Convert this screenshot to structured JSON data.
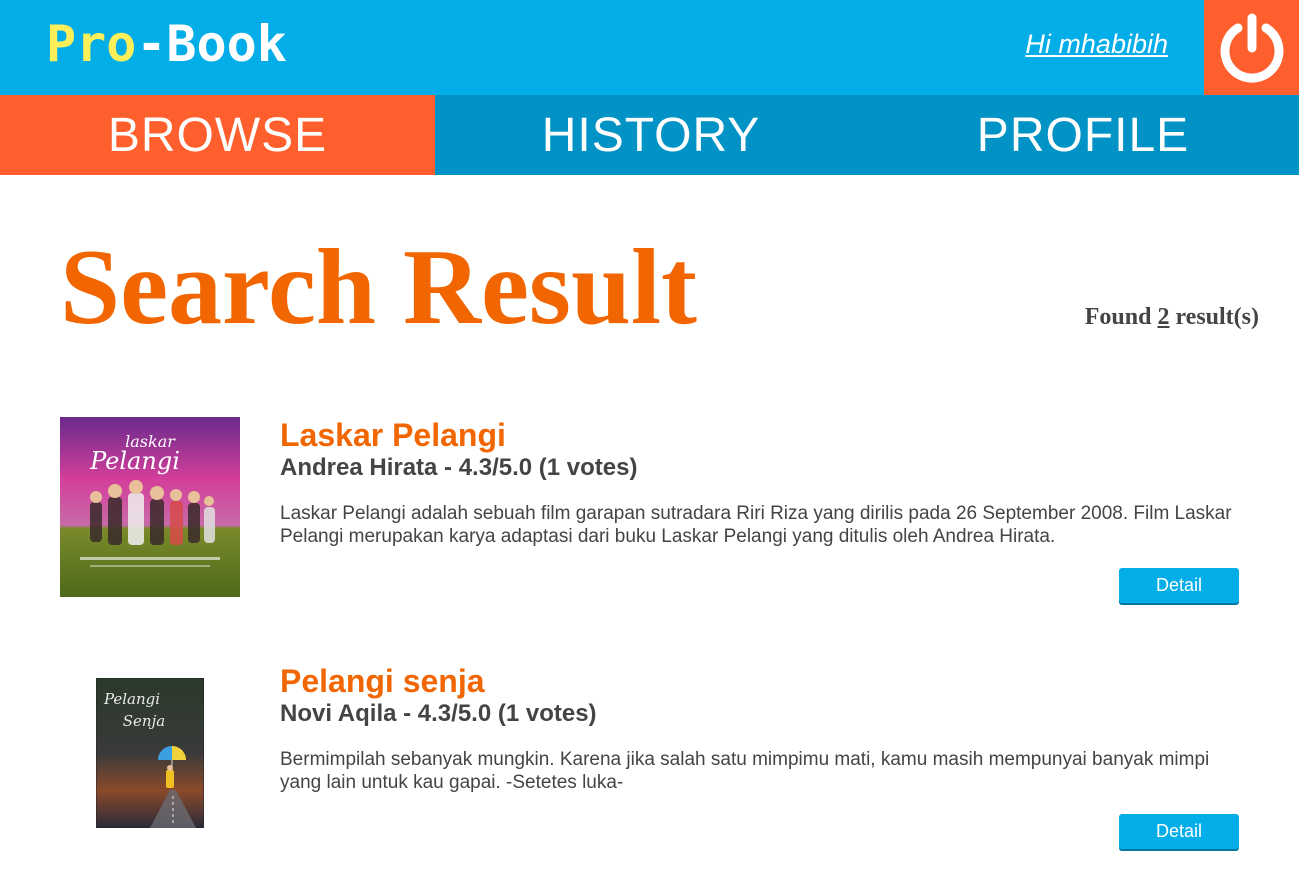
{
  "header": {
    "logo_part1": "Pro",
    "logo_part2": "-Book",
    "greeting": "Hi mhabibih",
    "logout_icon": "power-icon",
    "colors": {
      "bar": "#03aee8",
      "logout": "#ff5f2c",
      "logo_accent": "#fdef5a"
    }
  },
  "nav": {
    "tabs": [
      {
        "label": "BROWSE",
        "active": true
      },
      {
        "label": "HISTORY",
        "active": false
      },
      {
        "label": "PROFILE",
        "active": false
      }
    ]
  },
  "main": {
    "title": "Search Result",
    "found_prefix": "Found",
    "found_count": "2",
    "found_suffix": "result(s)",
    "results": [
      {
        "title": "Laskar Pelangi",
        "meta": "Andrea Hirata - 4.3/5.0 (1 votes)",
        "description": "Laskar Pelangi adalah sebuah film garapan sutradara Riri Riza yang dirilis pada 26 September 2008. Film Laskar Pelangi merupakan karya adaptasi dari buku Laskar Pelangi yang ditulis oleh Andrea Hirata.",
        "button": "Detail",
        "cover_title_line1": "laskar",
        "cover_title_line2": "Pelangi"
      },
      {
        "title": "Pelangi senja",
        "meta": "Novi Aqila - 4.3/5.0 (1 votes)",
        "description": "Bermimpilah sebanyak mungkin. Karena jika salah satu mimpimu mati, kamu masih mempunyai banyak mimpi yang lain untuk kau gapai. -Setetes luka-",
        "button": "Detail",
        "cover_title_line1": "Pelangi",
        "cover_title_line2": "Senja"
      }
    ]
  }
}
